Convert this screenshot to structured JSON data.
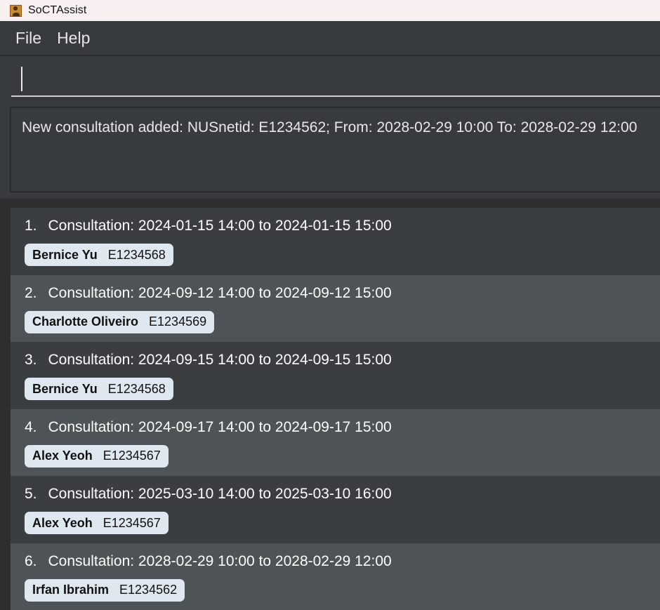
{
  "window": {
    "title": "SoCTAssist"
  },
  "menu": {
    "items": [
      "File",
      "Help"
    ]
  },
  "command": {
    "value": "",
    "placeholder": ""
  },
  "result": {
    "text": "New consultation added: NUSnetid: E1234562; From: 2028-02-29 10:00 To: 2028-02-29 12:00"
  },
  "consultations": [
    {
      "index": "1.",
      "text": "Consultation: 2024-01-15 14:00 to 2024-01-15 15:00",
      "student_name": "Bernice Yu",
      "student_id": "E1234568"
    },
    {
      "index": "2.",
      "text": "Consultation: 2024-09-12 14:00 to 2024-09-12 15:00",
      "student_name": "Charlotte Oliveiro",
      "student_id": "E1234569"
    },
    {
      "index": "3.",
      "text": "Consultation: 2024-09-15 14:00 to 2024-09-15 15:00",
      "student_name": "Bernice Yu",
      "student_id": "E1234568"
    },
    {
      "index": "4.",
      "text": "Consultation: 2024-09-17 14:00 to 2024-09-17 15:00",
      "student_name": "Alex Yeoh",
      "student_id": "E1234567"
    },
    {
      "index": "5.",
      "text": "Consultation: 2025-03-10 14:00 to 2025-03-10 16:00",
      "student_name": "Alex Yeoh",
      "student_id": "E1234567"
    },
    {
      "index": "6.",
      "text": "Consultation: 2028-02-29 10:00 to 2028-02-29 12:00",
      "student_name": "Irfan Ibrahim",
      "student_id": "E1234562"
    }
  ],
  "colors": {
    "background": "#383b3e",
    "row_odd": "#3b3e41",
    "row_even": "#4d5356",
    "tag": "#dfe8f1",
    "titlebar": "#f8eff1"
  },
  "icons": {
    "app": "address-book-icon"
  }
}
